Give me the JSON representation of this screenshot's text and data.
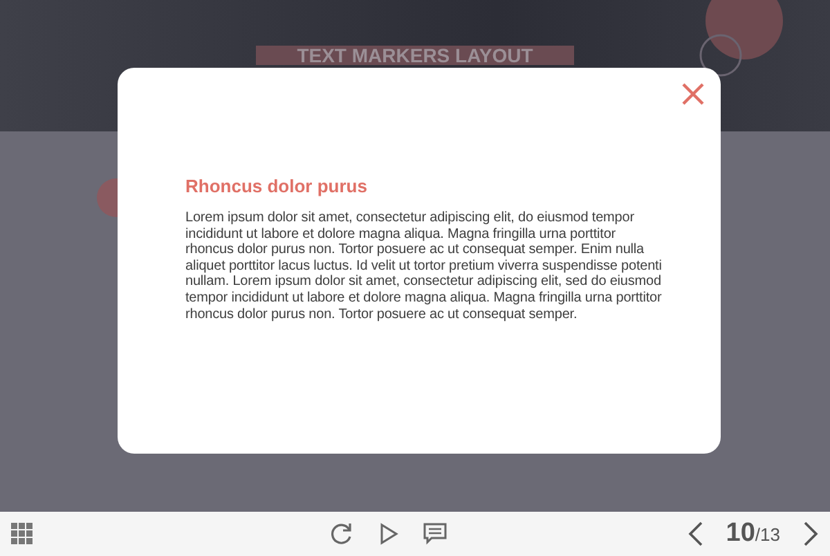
{
  "slide": {
    "title": "TEXT MARKERS LAYOUT"
  },
  "modal": {
    "heading": "Rhoncus dolor purus",
    "body": "Lorem ipsum dolor sit amet, consectetur adipiscing elit, do eiusmod tempor incididunt ut labore et dolore magna aliqua. Magna fringilla urna porttitor rhoncus dolor purus non. Tortor posuere ac ut consequat semper. Enim nulla aliquet porttitor lacus luctus. Id velit ut tortor pretium viverra suspendisse potenti nullam. Lorem ipsum dolor sit amet, consectetur adipiscing elit, sed do eiusmod tempor incididunt ut labore et dolore magna aliqua. Magna fringilla urna porttitor rhoncus dolor purus non. Tortor posuere ac ut consequat semper."
  },
  "player_bar": {
    "current_page": "10",
    "total_pages": "/13"
  }
}
